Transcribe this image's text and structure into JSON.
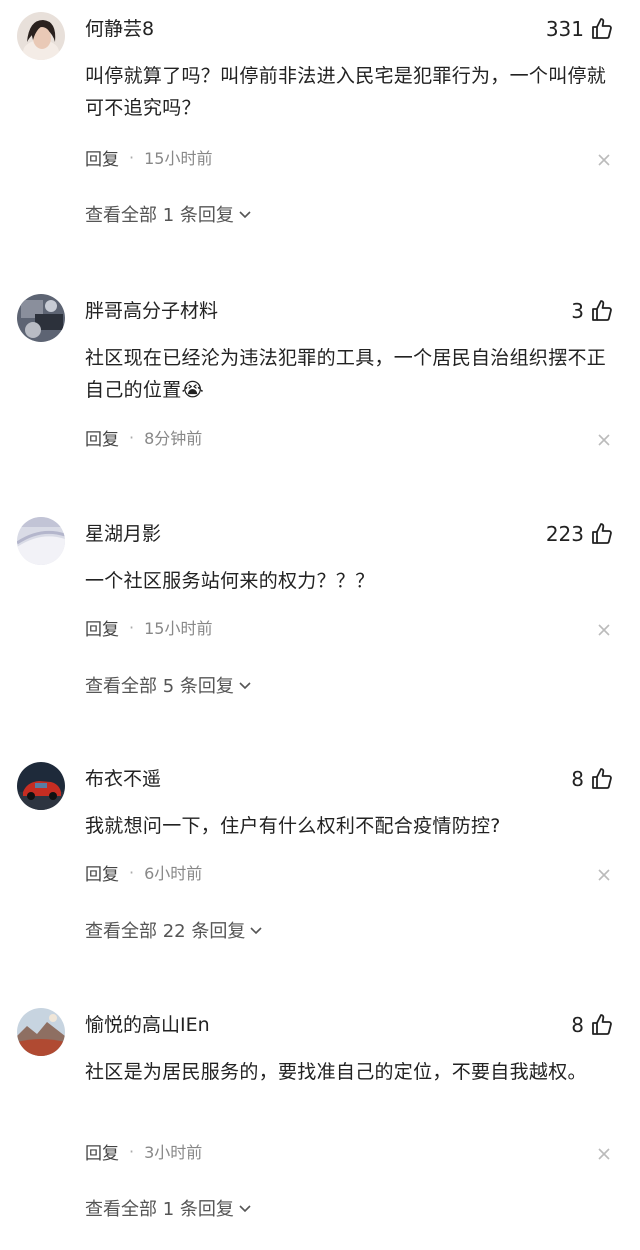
{
  "comments": [
    {
      "username": "何静芸8",
      "likes": "331",
      "text": "叫停就算了吗？叫停前非法进入民宅是犯罪行为，一个叫停就可不追究吗？",
      "reply_label": "回复",
      "time": "15小时前",
      "view_all": "查看全部 1 条回复"
    },
    {
      "username": "胖哥高分子材料",
      "likes": "3",
      "text": "社区现在已经沦为违法犯罪的工具，一个居民自治组织摆不正自己的位置😭",
      "reply_label": "回复",
      "time": "8分钟前"
    },
    {
      "username": "星湖月影",
      "likes": "223",
      "text": "一个社区服务站何来的权力？？？",
      "reply_label": "回复",
      "time": "15小时前",
      "view_all": "查看全部 5 条回复"
    },
    {
      "username": "布衣不遥",
      "likes": "8",
      "text": "我就想问一下，住户有什么权利不配合疫情防控?",
      "reply_label": "回复",
      "time": "6小时前",
      "view_all": "查看全部 22 条回复"
    },
    {
      "username": "愉悦的高山IEn",
      "likes": "8",
      "text": "社区是为居民服务的，要找准自己的定位，不要自我越权。",
      "reply_label": "回复",
      "time": "3小时前",
      "view_all": "查看全部 1 条回复"
    }
  ],
  "colors": {
    "text": "#222222",
    "meta": "#888888",
    "view_all": "#555555"
  },
  "icons": {
    "like": "thumbs-up-icon",
    "close": "close-icon",
    "expand": "chevron-down-icon"
  }
}
